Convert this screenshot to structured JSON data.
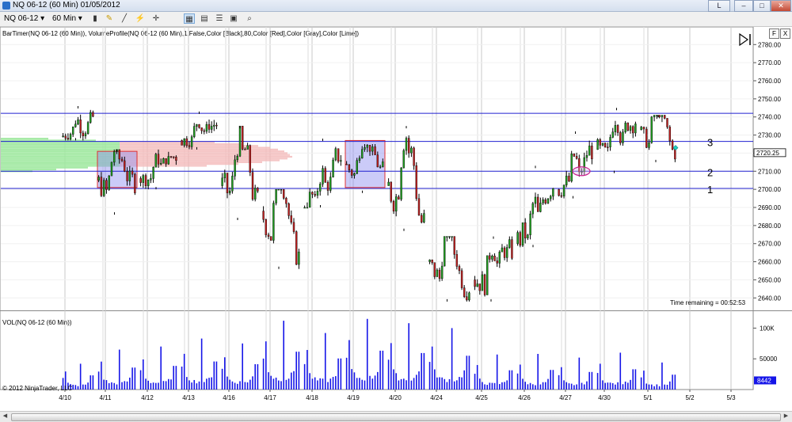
{
  "window": {
    "title": "NQ 06-12 (60 Min)  01/05/2012",
    "buttons": [
      "L",
      "–",
      "□",
      "✕"
    ]
  },
  "toolbar": {
    "instrument": "NQ 06-12",
    "interval": "60 Min",
    "icons": [
      "candlestick-icon",
      "pencil-icon",
      "line-draw-icon",
      "crosshair-icon",
      "chart-style-icon",
      "data-box-icon",
      "properties-icon",
      "indicators-icon",
      "strategy-icon",
      "zoom-icon"
    ]
  },
  "chart": {
    "indicator_label": "BarTimer(NQ 06-12 (60 Min)), VolumeProfile(NQ 06-12 (60 Min),1,False,Color [Black],80,Color [Red],Color [Gray],Color [Lime])",
    "volume_label": "VOL(NQ 06-12 (60 Min))",
    "time_remaining": "Time remaining = 00:52:53",
    "copyright": "© 2012 NinjaTrader, LLC",
    "side_buttons": [
      "F",
      "X"
    ]
  },
  "chart_data": {
    "type": "candlestick",
    "price_axis": {
      "range": [
        2634,
        2788
      ],
      "ticks": [
        2640,
        2650,
        2660,
        2670,
        2680,
        2690,
        2700,
        2710,
        2720,
        2730,
        2740,
        2750,
        2760,
        2770,
        2780
      ],
      "tick_labels": [
        "2640.00",
        "2650.00",
        "2660.00",
        "2670.00",
        "2680.00",
        "2690.00",
        "2700.00",
        "2710.00",
        "2720.00",
        "2730.00",
        "2740.00",
        "2750.00",
        "2760.00",
        "2770.00",
        "2780.00"
      ],
      "last_price": "2720.25"
    },
    "volume_axis": {
      "range": [
        0,
        125000
      ],
      "ticks": [
        50000,
        100000
      ],
      "tick_labels": [
        "50000",
        "100K"
      ],
      "last_volume": "8442"
    },
    "x_axis": {
      "labels": [
        "4/10",
        "4/11",
        "4/12",
        "4/13",
        "4/16",
        "4/17",
        "4/18",
        "4/19",
        "4/20",
        "4/24",
        "4/25",
        "4/26",
        "4/27",
        "4/30",
        "5/1",
        "5/2",
        "5/3"
      ]
    },
    "horizontal_lines": [
      {
        "price": 2742,
        "label": ""
      },
      {
        "price": 2726.5,
        "label": "3"
      },
      {
        "price": 2710,
        "label": "2"
      },
      {
        "price": 2700.5,
        "label": "1"
      }
    ],
    "boxes": [
      {
        "session": 1,
        "high": 2721,
        "low": 2701
      },
      {
        "session": 7,
        "high": 2727,
        "low": 2701
      }
    ],
    "marker_ellipse": {
      "session": 12,
      "price": 2710
    },
    "sessions": [
      {
        "date": "4/10",
        "open": 2729,
        "high": 2746,
        "low": 2727,
        "close": 2740
      },
      {
        "date": "4/11",
        "open": 2705,
        "high": 2722,
        "low": 2686,
        "close": 2704
      },
      {
        "date": "4/12",
        "open": 2706,
        "high": 2722,
        "low": 2700,
        "close": 2718
      },
      {
        "date": "4/13",
        "open": 2727,
        "high": 2743,
        "low": 2722,
        "close": 2736
      },
      {
        "date": "4/16",
        "open": 2702,
        "high": 2735,
        "low": 2683,
        "close": 2693
      },
      {
        "date": "4/17",
        "open": 2688,
        "high": 2700,
        "low": 2656,
        "close": 2662
      },
      {
        "date": "4/18",
        "open": 2690,
        "high": 2728,
        "low": 2690,
        "close": 2718
      },
      {
        "date": "4/19",
        "open": 2714,
        "high": 2725,
        "low": 2698,
        "close": 2711
      },
      {
        "date": "4/20",
        "open": 2702,
        "high": 2735,
        "low": 2677,
        "close": 2681
      },
      {
        "date": "4/24",
        "open": 2660,
        "high": 2674,
        "low": 2638,
        "close": 2646
      },
      {
        "date": "4/25",
        "open": 2650,
        "high": 2674,
        "low": 2638,
        "close": 2666
      },
      {
        "date": "4/26",
        "open": 2670,
        "high": 2713,
        "low": 2668,
        "close": 2703
      },
      {
        "date": "4/27",
        "open": 2700,
        "high": 2732,
        "low": 2695,
        "close": 2722
      },
      {
        "date": "4/30",
        "open": 2722,
        "high": 2745,
        "low": 2709,
        "close": 2738
      },
      {
        "date": "5/1",
        "open": 2733,
        "high": 2741,
        "low": 2715,
        "close": 2720
      }
    ],
    "volume_peaks_k": [
      42,
      65,
      70,
      83,
      75,
      112,
      92,
      115,
      108,
      100,
      57,
      58,
      52,
      60,
      44
    ]
  }
}
